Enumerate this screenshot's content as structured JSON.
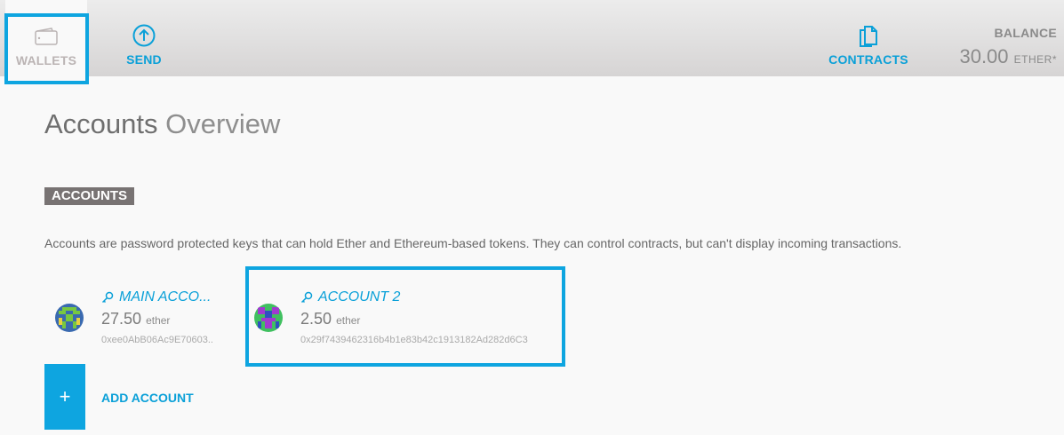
{
  "nav": {
    "wallets_label": "WALLETS",
    "send_label": "SEND",
    "contracts_label": "CONTRACTS"
  },
  "balance": {
    "label": "BALANCE",
    "value": "30.00",
    "unit": "ETHER*"
  },
  "page": {
    "title_strong": "Accounts",
    "title_light": "Overview"
  },
  "section": {
    "badge": "ACCOUNTS",
    "description": "Accounts are password protected keys that can hold Ether and Ethereum-based tokens. They can control contracts, but can't display incoming transactions."
  },
  "accounts": [
    {
      "name": "MAIN ACCO...",
      "balance": "27.50",
      "unit": "ether",
      "address": "0xee0AbB06Ac9E70603..",
      "avatar_colors": [
        "#3a6ab0",
        "#78c840"
      ]
    },
    {
      "name": "ACCOUNT 2",
      "balance": "2.50",
      "unit": "ether",
      "address": "0x29f7439462316b4b1e83b42c1913182Ad282d6C3",
      "avatar_colors": [
        "#a03ad0",
        "#40c060"
      ]
    }
  ],
  "add_account": {
    "plus": "+",
    "label": "ADD ACCOUNT"
  },
  "colors": {
    "accent": "#0aa0d8",
    "highlight": "#0ea5e0",
    "badge_bg": "#787373"
  }
}
